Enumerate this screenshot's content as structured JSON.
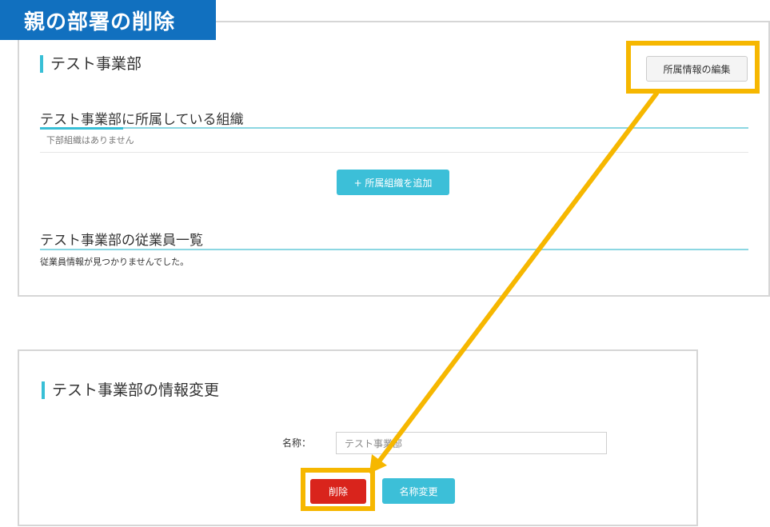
{
  "banner": {
    "title": "親の部署の削除"
  },
  "org_panel": {
    "heading": "テスト事業部",
    "edit_button": "所属情報の編集",
    "sub_orgs_title": "テスト事業部に所属している組織",
    "sub_orgs_empty": "下部組織はありません",
    "add_button": "+ 所属組織を追加",
    "employees_title": "テスト事業部の従業員一覧",
    "employees_empty": "従業員情報が見つかりませんでした。"
  },
  "edit_panel": {
    "heading": "テスト事業部の情報変更",
    "name_label": "名称：",
    "name_value": "テスト事業部",
    "delete_button": "削除",
    "rename_button": "名称変更"
  },
  "colors": {
    "banner": "#1170bf",
    "accent": "#38bfd6",
    "highlight": "#f6b700",
    "danger": "#d9241c"
  }
}
